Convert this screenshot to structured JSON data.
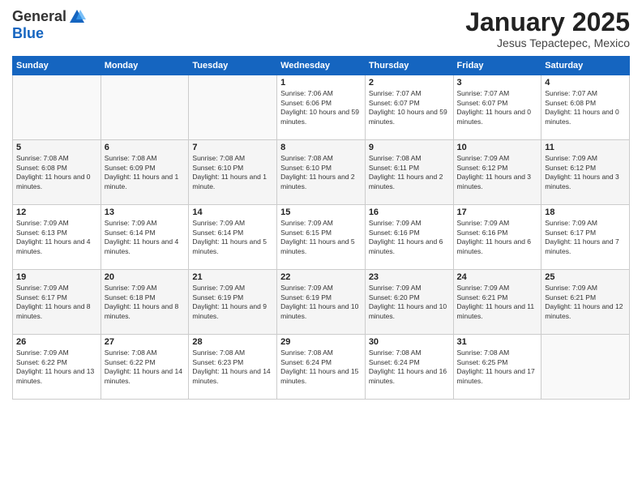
{
  "header": {
    "logo_general": "General",
    "logo_blue": "Blue",
    "month_title": "January 2025",
    "location": "Jesus Tepactepec, Mexico"
  },
  "days_of_week": [
    "Sunday",
    "Monday",
    "Tuesday",
    "Wednesday",
    "Thursday",
    "Friday",
    "Saturday"
  ],
  "weeks": [
    [
      {
        "day": "",
        "text": ""
      },
      {
        "day": "",
        "text": ""
      },
      {
        "day": "",
        "text": ""
      },
      {
        "day": "1",
        "text": "Sunrise: 7:06 AM\nSunset: 6:06 PM\nDaylight: 10 hours and 59 minutes."
      },
      {
        "day": "2",
        "text": "Sunrise: 7:07 AM\nSunset: 6:07 PM\nDaylight: 10 hours and 59 minutes."
      },
      {
        "day": "3",
        "text": "Sunrise: 7:07 AM\nSunset: 6:07 PM\nDaylight: 11 hours and 0 minutes."
      },
      {
        "day": "4",
        "text": "Sunrise: 7:07 AM\nSunset: 6:08 PM\nDaylight: 11 hours and 0 minutes."
      }
    ],
    [
      {
        "day": "5",
        "text": "Sunrise: 7:08 AM\nSunset: 6:08 PM\nDaylight: 11 hours and 0 minutes."
      },
      {
        "day": "6",
        "text": "Sunrise: 7:08 AM\nSunset: 6:09 PM\nDaylight: 11 hours and 1 minute."
      },
      {
        "day": "7",
        "text": "Sunrise: 7:08 AM\nSunset: 6:10 PM\nDaylight: 11 hours and 1 minute."
      },
      {
        "day": "8",
        "text": "Sunrise: 7:08 AM\nSunset: 6:10 PM\nDaylight: 11 hours and 2 minutes."
      },
      {
        "day": "9",
        "text": "Sunrise: 7:08 AM\nSunset: 6:11 PM\nDaylight: 11 hours and 2 minutes."
      },
      {
        "day": "10",
        "text": "Sunrise: 7:09 AM\nSunset: 6:12 PM\nDaylight: 11 hours and 3 minutes."
      },
      {
        "day": "11",
        "text": "Sunrise: 7:09 AM\nSunset: 6:12 PM\nDaylight: 11 hours and 3 minutes."
      }
    ],
    [
      {
        "day": "12",
        "text": "Sunrise: 7:09 AM\nSunset: 6:13 PM\nDaylight: 11 hours and 4 minutes."
      },
      {
        "day": "13",
        "text": "Sunrise: 7:09 AM\nSunset: 6:14 PM\nDaylight: 11 hours and 4 minutes."
      },
      {
        "day": "14",
        "text": "Sunrise: 7:09 AM\nSunset: 6:14 PM\nDaylight: 11 hours and 5 minutes."
      },
      {
        "day": "15",
        "text": "Sunrise: 7:09 AM\nSunset: 6:15 PM\nDaylight: 11 hours and 5 minutes."
      },
      {
        "day": "16",
        "text": "Sunrise: 7:09 AM\nSunset: 6:16 PM\nDaylight: 11 hours and 6 minutes."
      },
      {
        "day": "17",
        "text": "Sunrise: 7:09 AM\nSunset: 6:16 PM\nDaylight: 11 hours and 6 minutes."
      },
      {
        "day": "18",
        "text": "Sunrise: 7:09 AM\nSunset: 6:17 PM\nDaylight: 11 hours and 7 minutes."
      }
    ],
    [
      {
        "day": "19",
        "text": "Sunrise: 7:09 AM\nSunset: 6:17 PM\nDaylight: 11 hours and 8 minutes."
      },
      {
        "day": "20",
        "text": "Sunrise: 7:09 AM\nSunset: 6:18 PM\nDaylight: 11 hours and 8 minutes."
      },
      {
        "day": "21",
        "text": "Sunrise: 7:09 AM\nSunset: 6:19 PM\nDaylight: 11 hours and 9 minutes."
      },
      {
        "day": "22",
        "text": "Sunrise: 7:09 AM\nSunset: 6:19 PM\nDaylight: 11 hours and 10 minutes."
      },
      {
        "day": "23",
        "text": "Sunrise: 7:09 AM\nSunset: 6:20 PM\nDaylight: 11 hours and 10 minutes."
      },
      {
        "day": "24",
        "text": "Sunrise: 7:09 AM\nSunset: 6:21 PM\nDaylight: 11 hours and 11 minutes."
      },
      {
        "day": "25",
        "text": "Sunrise: 7:09 AM\nSunset: 6:21 PM\nDaylight: 11 hours and 12 minutes."
      }
    ],
    [
      {
        "day": "26",
        "text": "Sunrise: 7:09 AM\nSunset: 6:22 PM\nDaylight: 11 hours and 13 minutes."
      },
      {
        "day": "27",
        "text": "Sunrise: 7:08 AM\nSunset: 6:22 PM\nDaylight: 11 hours and 14 minutes."
      },
      {
        "day": "28",
        "text": "Sunrise: 7:08 AM\nSunset: 6:23 PM\nDaylight: 11 hours and 14 minutes."
      },
      {
        "day": "29",
        "text": "Sunrise: 7:08 AM\nSunset: 6:24 PM\nDaylight: 11 hours and 15 minutes."
      },
      {
        "day": "30",
        "text": "Sunrise: 7:08 AM\nSunset: 6:24 PM\nDaylight: 11 hours and 16 minutes."
      },
      {
        "day": "31",
        "text": "Sunrise: 7:08 AM\nSunset: 6:25 PM\nDaylight: 11 hours and 17 minutes."
      },
      {
        "day": "",
        "text": ""
      }
    ]
  ]
}
